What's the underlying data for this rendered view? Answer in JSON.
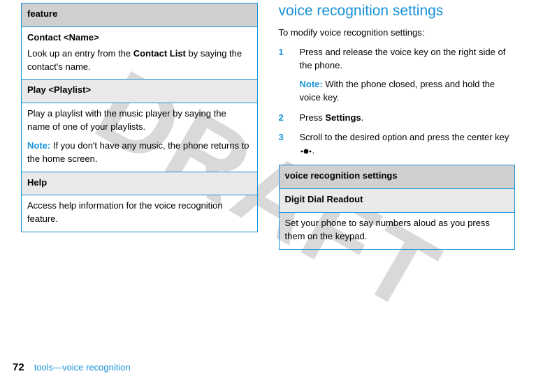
{
  "watermark": "DRAFT",
  "left_table": {
    "header": "feature",
    "rows": [
      {
        "title": "Contact <Name>",
        "body_pre": "Look up an entry from the ",
        "body_bold": "Contact List",
        "body_post": " by saying the contact's name."
      },
      {
        "title": "Play <Playlist>",
        "body": "Play a playlist with the music player by saying the name of one of your playlists.",
        "note_label": "Note:",
        "note_text": " If you don't have any music, the phone returns to the home screen."
      },
      {
        "title": "Help",
        "body": "Access help information for the voice recognition feature."
      }
    ]
  },
  "right": {
    "title": "voice recognition settings",
    "intro": "To modify voice recognition settings:",
    "steps": [
      {
        "num": "1",
        "text": "Press and release the voice key on the right side of the phone.",
        "subnote_label": "Note:",
        "subnote_text": " With the phone closed, press and hold the voice key."
      },
      {
        "num": "2",
        "text_pre": "Press ",
        "text_bold": "Settings",
        "text_post": "."
      },
      {
        "num": "3",
        "text_pre": "Scroll to the desired option and press the center key ",
        "text_post": "."
      }
    ],
    "table": {
      "header": "voice recognition settings",
      "row_title": "Digit Dial Readout",
      "row_body": "Set your phone to say numbers aloud as you press them on the keypad."
    }
  },
  "footer": {
    "page": "72",
    "breadcrumb": "tools—voice recognition"
  }
}
